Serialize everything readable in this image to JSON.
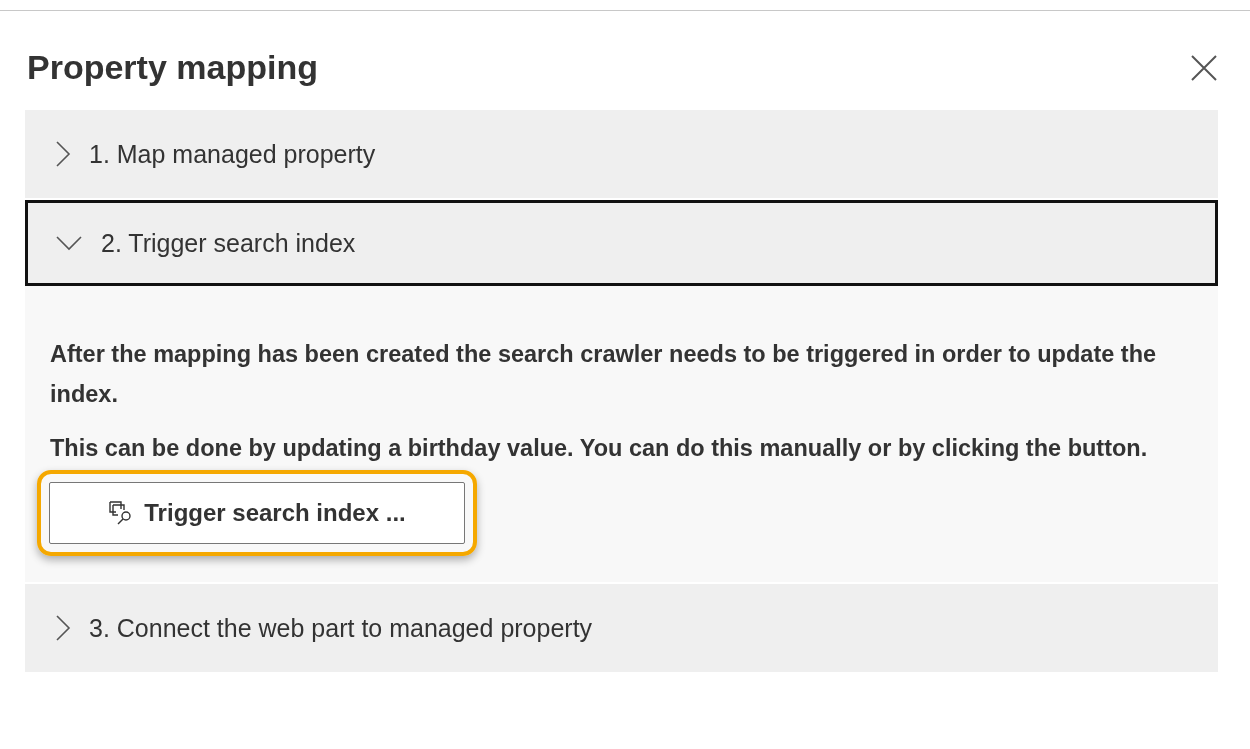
{
  "panel": {
    "title": "Property mapping"
  },
  "sections": [
    {
      "label": "1. Map managed property",
      "expanded": false
    },
    {
      "label": "2. Trigger search index",
      "expanded": true,
      "focused": true,
      "paragraphs": [
        "After the mapping has been created the search crawler needs to be triggered in order to update the index.",
        "This can be done by updating a birthday value. You can do this manually or by clicking the button."
      ],
      "button": {
        "label": "Trigger search index ...",
        "highlighted": true
      }
    },
    {
      "label": "3. Connect the web part to managed property",
      "expanded": false
    }
  ]
}
